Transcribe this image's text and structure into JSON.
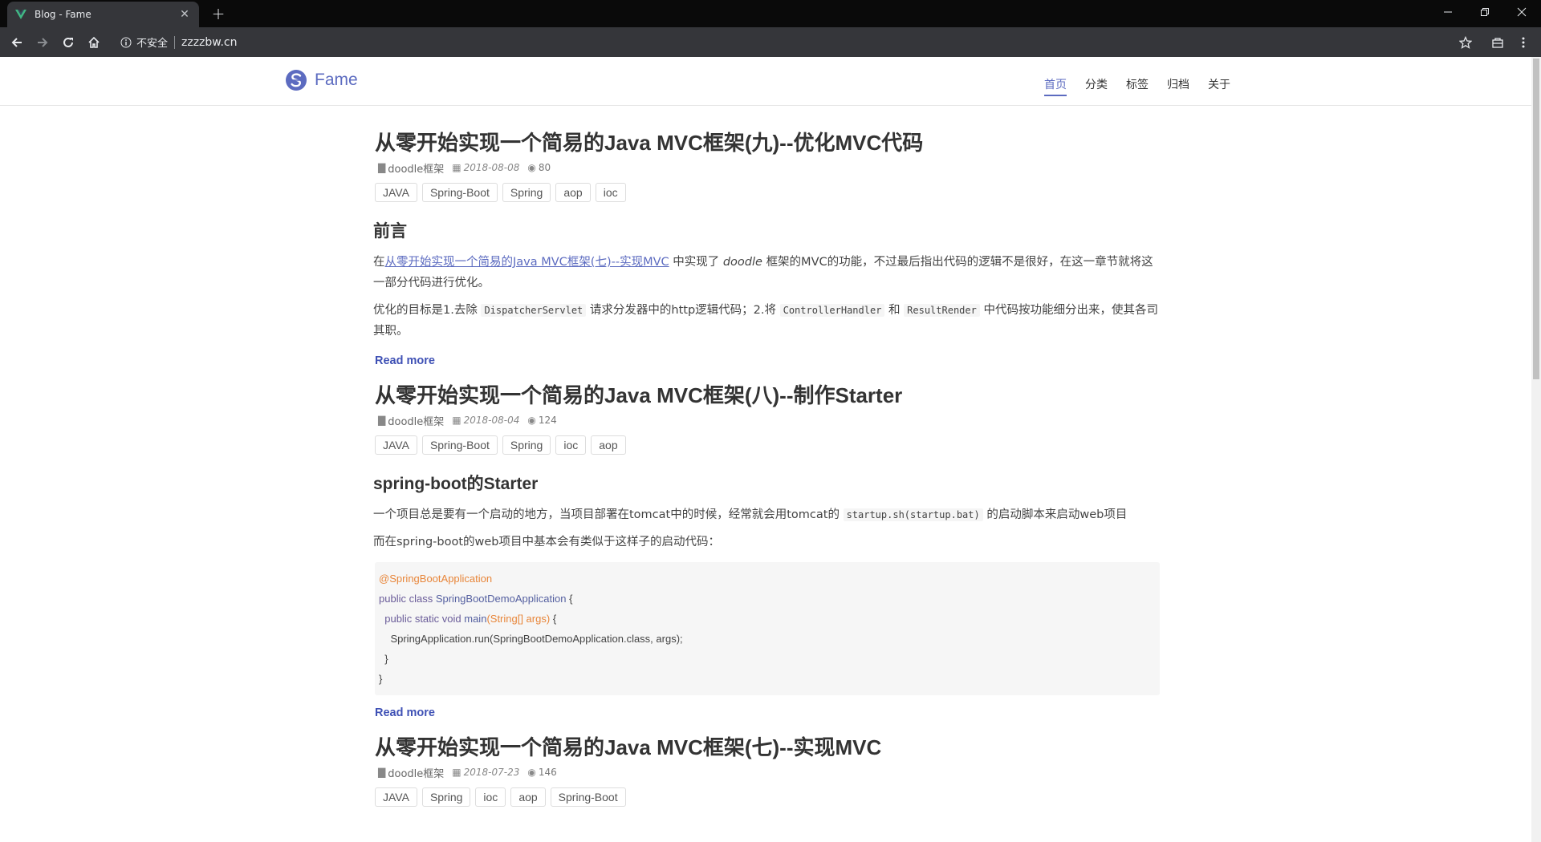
{
  "browser": {
    "tab_title": "Blog - Fame",
    "security_label": "不安全",
    "url": "zzzzbw.cn"
  },
  "site": {
    "brand": "Fame",
    "nav": [
      "首页",
      "分类",
      "标签",
      "归档",
      "关于"
    ],
    "active_nav": "首页"
  },
  "posts": [
    {
      "title": "从零开始实现一个简易的Java MVC框架(九)--优化MVC代码",
      "category": "doodle框架",
      "date": "2018-08-08",
      "views": "80",
      "tags": [
        "JAVA",
        "Spring-Boot",
        "Spring",
        "aop",
        "ioc"
      ],
      "heading": "前言",
      "p1_prefix": "在",
      "p1_link": "从零开始实现一个简易的Java MVC框架(七)--实现MVC",
      "p1_mid": "中实现了",
      "p1_em": "doodle",
      "p1_suffix": "框架的MVC的功能，不过最后指出代码的逻辑不是很好，在这一章节就将这一部分代码进行优化。",
      "p2_a": "优化的目标是1.去除",
      "p2_code1": "DispatcherServlet",
      "p2_b": "请求分发器中的http逻辑代码；2.将",
      "p2_code2": "ControllerHandler",
      "p2_c": "和",
      "p2_code3": "ResultRender",
      "p2_d": "中代码按功能细分出来，使其各司其职。",
      "read_more": "Read more"
    },
    {
      "title": "从零开始实现一个简易的Java MVC框架(八)--制作Starter",
      "category": "doodle框架",
      "date": "2018-08-04",
      "views": "124",
      "tags": [
        "JAVA",
        "Spring-Boot",
        "Spring",
        "ioc",
        "aop"
      ],
      "heading": "spring-boot的Starter",
      "p1_a": "一个项目总是要有一个启动的地方，当项目部署在tomcat中的时候，经常就会用tomcat的",
      "p1_code": "startup.sh(startup.bat)",
      "p1_b": "的启动脚本来启动web项目",
      "p2": "而在spring-boot的web项目中基本会有类似于这样子的启动代码：",
      "code": {
        "l1": "@SpringBootApplication",
        "l2_kw": "public class",
        "l2_cls": "SpringBootDemoApplication",
        "l2_end": "{",
        "l3_kw": "public static void",
        "l3_fn": "main",
        "l3_args": "(String[] args)",
        "l3_end": "{",
        "l4": "SpringApplication.run(SpringBootDemoApplication.class, args);",
        "l5": "}",
        "l6": "}"
      },
      "read_more": "Read more"
    },
    {
      "title": "从零开始实现一个简易的Java MVC框架(七)--实现MVC",
      "category": "doodle框架",
      "date": "2018-07-23",
      "views": "146",
      "tags": [
        "JAVA",
        "Spring",
        "ioc",
        "aop",
        "Spring-Boot"
      ]
    }
  ]
}
